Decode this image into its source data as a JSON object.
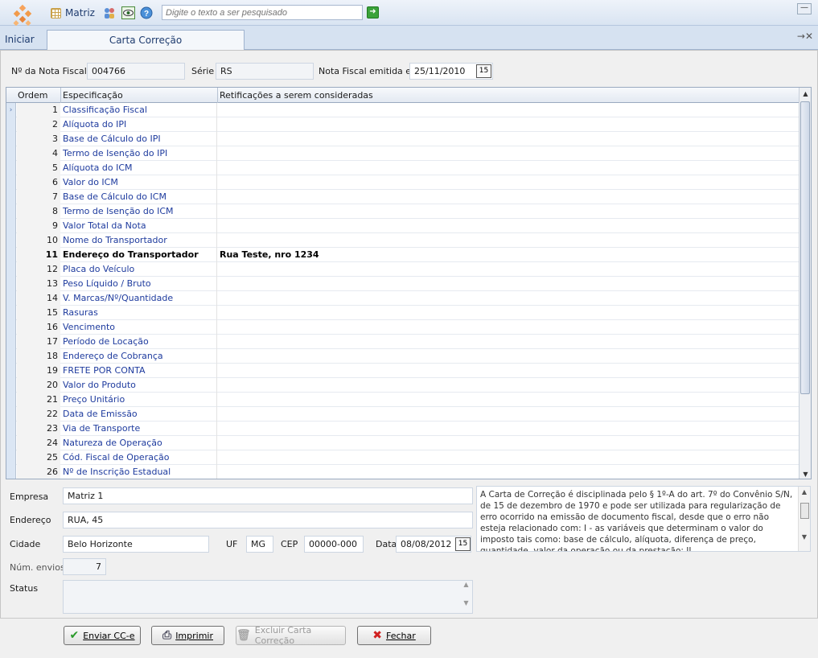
{
  "toolbar": {
    "matriz_label": "Matriz",
    "search_placeholder": "Digite o texto a ser pesquisado"
  },
  "tabs": {
    "home": "Iniciar",
    "active": "Carta Correção"
  },
  "header": {
    "nota_label": "Nº da Nota Fiscal",
    "nota_value": "004766",
    "serie_label": "Série",
    "serie_value": "RS",
    "emitida_label": "Nota Fiscal emitida em",
    "emitida_value": "25/11/2010"
  },
  "grid": {
    "columns": [
      "Ordem",
      "Especificação",
      "Retificações a serem consideradas"
    ],
    "rows": [
      {
        "ordem": "1",
        "spec": "Classificação Fiscal",
        "ret": ""
      },
      {
        "ordem": "2",
        "spec": "Alíquota do IPI",
        "ret": ""
      },
      {
        "ordem": "3",
        "spec": "Base de Cálculo do IPI",
        "ret": ""
      },
      {
        "ordem": "4",
        "spec": "Termo de Isenção do IPI",
        "ret": ""
      },
      {
        "ordem": "5",
        "spec": "Alíquota do ICM",
        "ret": ""
      },
      {
        "ordem": "6",
        "spec": "Valor do ICM",
        "ret": ""
      },
      {
        "ordem": "7",
        "spec": "Base de Cálculo do ICM",
        "ret": ""
      },
      {
        "ordem": "8",
        "spec": "Termo de Isenção do ICM",
        "ret": ""
      },
      {
        "ordem": "9",
        "spec": "Valor Total da Nota",
        "ret": ""
      },
      {
        "ordem": "10",
        "spec": "Nome do Transportador",
        "ret": ""
      },
      {
        "ordem": "11",
        "spec": "Endereço do Transportador",
        "ret": "Rua Teste, nro 1234"
      },
      {
        "ordem": "12",
        "spec": "Placa do Veículo",
        "ret": ""
      },
      {
        "ordem": "13",
        "spec": "Peso Líquido / Bruto",
        "ret": ""
      },
      {
        "ordem": "14",
        "spec": "V. Marcas/Nº/Quantidade",
        "ret": ""
      },
      {
        "ordem": "15",
        "spec": "Rasuras",
        "ret": ""
      },
      {
        "ordem": "16",
        "spec": "Vencimento",
        "ret": ""
      },
      {
        "ordem": "17",
        "spec": "Período de Locação",
        "ret": ""
      },
      {
        "ordem": "18",
        "spec": "Endereço de Cobrança",
        "ret": ""
      },
      {
        "ordem": "19",
        "spec": "FRETE POR CONTA",
        "ret": ""
      },
      {
        "ordem": "20",
        "spec": "Valor do Produto",
        "ret": ""
      },
      {
        "ordem": "21",
        "spec": "Preço Unitário",
        "ret": ""
      },
      {
        "ordem": "22",
        "spec": "Data de Emissão",
        "ret": ""
      },
      {
        "ordem": "23",
        "spec": "Via de Transporte",
        "ret": ""
      },
      {
        "ordem": "24",
        "spec": "Natureza de Operação",
        "ret": ""
      },
      {
        "ordem": "25",
        "spec": "Cód. Fiscal de Operação",
        "ret": ""
      },
      {
        "ordem": "26",
        "spec": "Nº de Inscrição Estadual",
        "ret": ""
      }
    ]
  },
  "form": {
    "empresa_label": "Empresa",
    "empresa_value": "Matriz 1",
    "endereco_label": "Endereço",
    "endereco_value": "RUA, 45",
    "cidade_label": "Cidade",
    "cidade_value": "Belo Horizonte",
    "uf_label": "UF",
    "uf_value": "MG",
    "cep_label": "CEP",
    "cep_value": "00000-000",
    "data_label": "Data",
    "data_value": "08/08/2012",
    "envios_label": "Núm. envios",
    "envios_value": "7",
    "status_label": "Status",
    "info_text": "A Carta de Correção é disciplinada pelo § 1º-A do art. 7º do Convênio S/N, de 15 de dezembro de 1970 e pode ser utilizada para regularização de erro ocorrido na emissão de documento fiscal, desde que o erro não esteja relacionado com: I - as variáveis que determinam o valor do imposto tais como: base de cálculo, alíquota, diferença de preço, quantidade, valor da operação ou da prestação; II"
  },
  "buttons": {
    "enviar": "Enviar CC-e",
    "imprimir": "Imprimir",
    "excluir": "Excluir Carta Correção",
    "fechar": "Fechar"
  },
  "calendar_icon_text": "15"
}
